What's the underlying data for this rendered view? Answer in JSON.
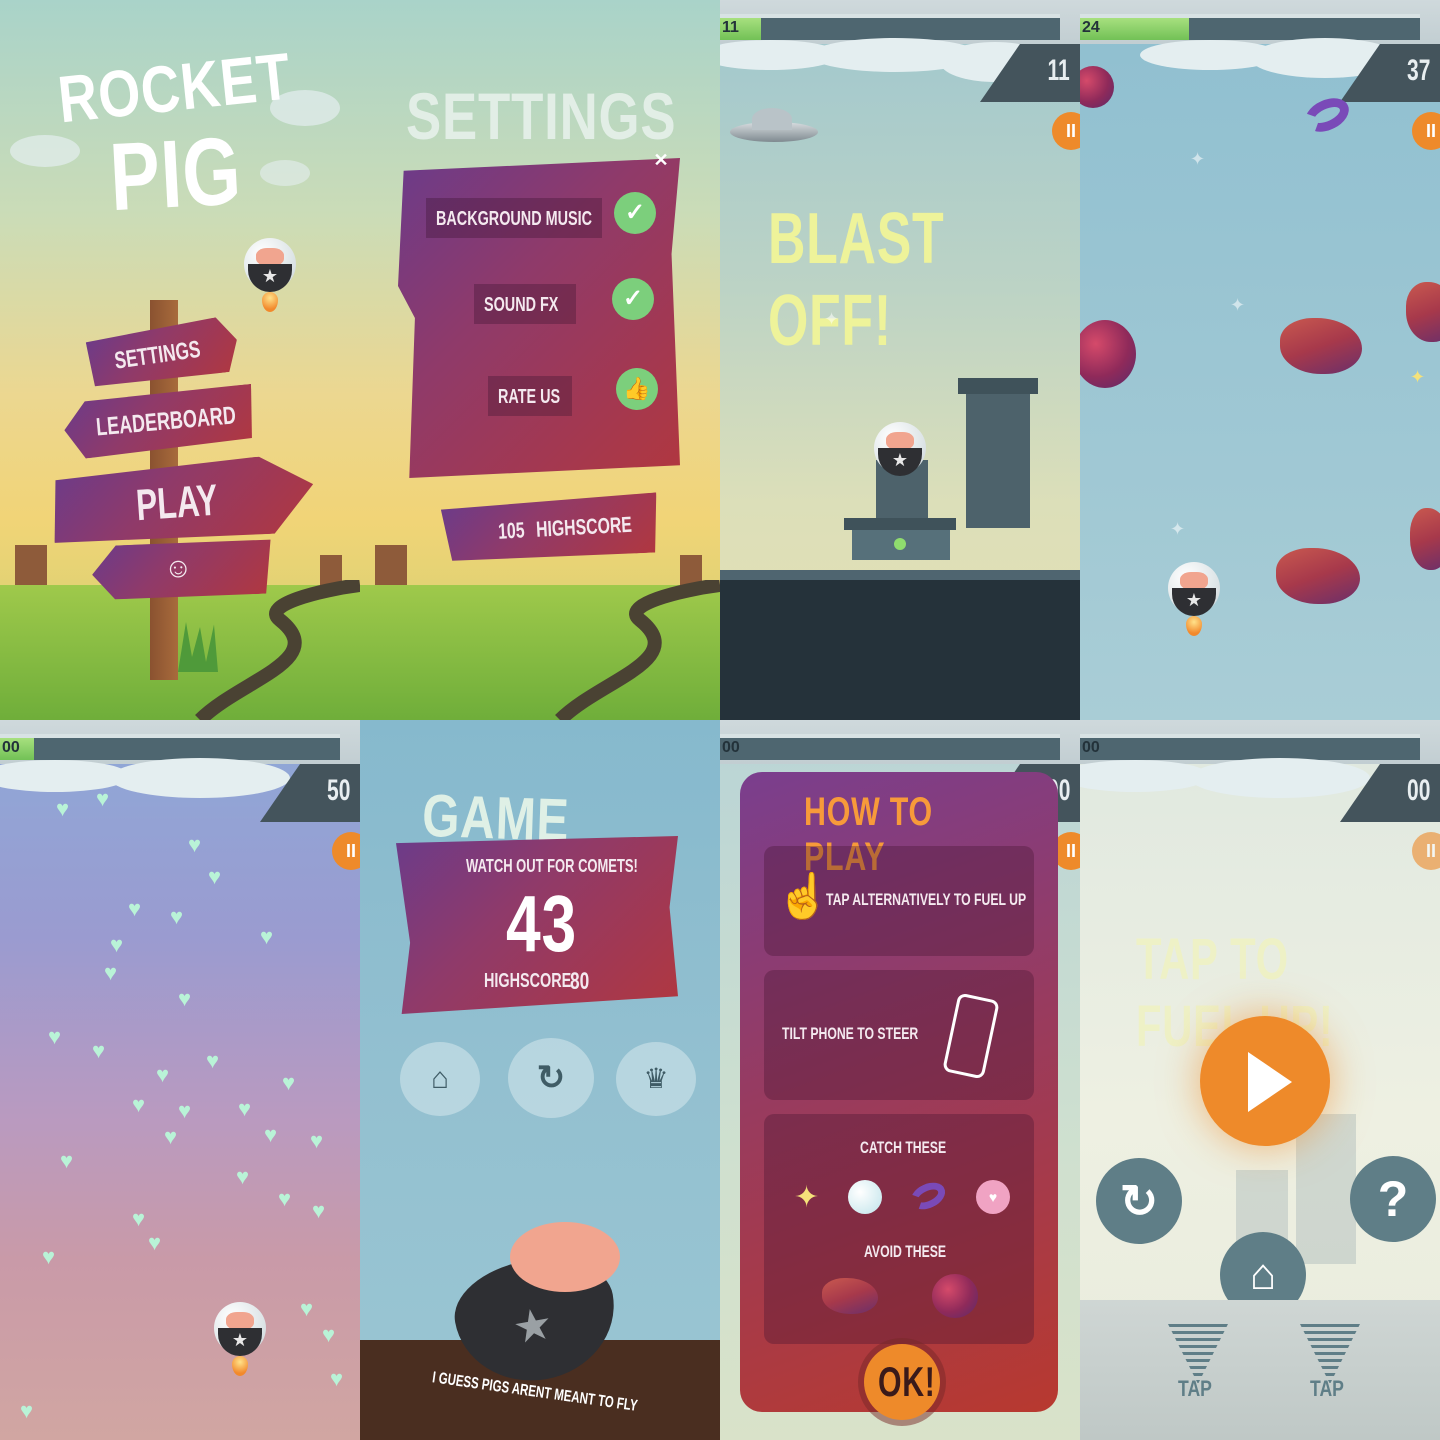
{
  "screens": {
    "menu": {
      "title_line1": "ROCKET",
      "title_line2": "PIG",
      "settings_label": "SETTINGS",
      "leaderboard_label": "LEADERBOARD",
      "play_label": "PLAY"
    },
    "settings": {
      "title": "SETTINGS",
      "close_glyph": "✕",
      "background_music_label": "BACKGROUND MUSIC",
      "sound_fx_label": "SOUND FX",
      "rate_us_label": "RATE US",
      "highscore_value": "105",
      "highscore_label": "HIGHSCORE",
      "background_music_enabled": true,
      "sound_fx_enabled": true
    },
    "launch": {
      "fuel_label": "11",
      "fuel_fraction": 0.12,
      "score": "11",
      "pause_glyph": "II",
      "headline": "BLAST OFF!"
    },
    "flight": {
      "fuel_label": "24",
      "fuel_fraction": 0.32,
      "score": "37",
      "pause_glyph": "II"
    },
    "hearts": {
      "fuel_label": "00",
      "fuel_fraction": 0.1,
      "score": "50",
      "pause_glyph": "II"
    },
    "game_over": {
      "title": "GAME OVER",
      "tip": "WATCH OUT FOR COMETS!",
      "score": "43",
      "highscore_label": "HIGHSCORE",
      "highscore_value": "80",
      "footer": "I GUESS PIGS ARENT MEANT TO FLY"
    },
    "how_to_play": {
      "fuel_label": "00",
      "score": "00",
      "pause_glyph": "II",
      "title": "HOW TO PLAY",
      "tap_instruction": "TAP ALTERNATIVELY TO FUEL UP",
      "tilt_instruction": "TILT PHONE TO STEER",
      "catch_label": "CATCH THESE",
      "avoid_label": "AVOID THESE",
      "ok_label": "OK!"
    },
    "fuel_up": {
      "fuel_label": "00",
      "score": "00",
      "pause_glyph": "II",
      "headline": "TAP TO FUEL UP!",
      "help_glyph": "?",
      "tap_left": "TAP",
      "tap_right": "TAP"
    }
  },
  "colors": {
    "plank": "#9b3a5c",
    "accent_orange": "#ee8a2a",
    "heart_green": "#b9f3d7",
    "check_green": "#7ccf7c",
    "hud_dark": "#44545c"
  },
  "icons": [
    "home-icon",
    "restart-icon",
    "crown-icon",
    "check-icon",
    "thumbs-up-icon",
    "play-icon",
    "help-icon",
    "hand-tap-icon",
    "phone-tilt-icon"
  ]
}
